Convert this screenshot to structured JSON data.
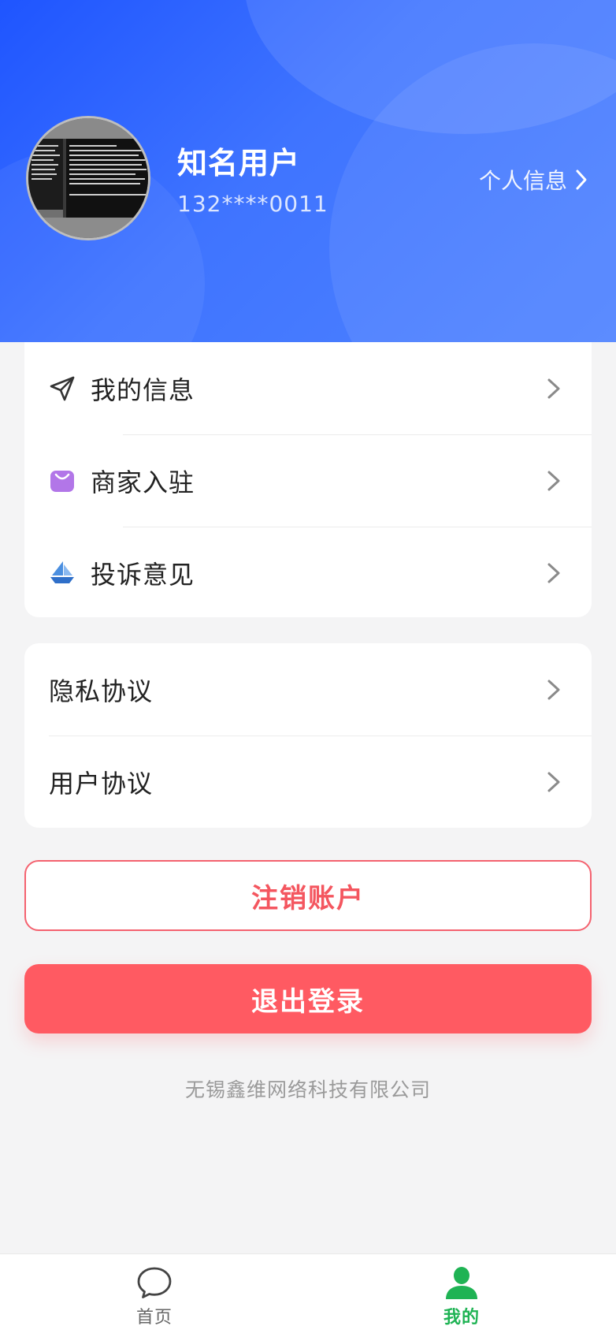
{
  "profile": {
    "name": "知名用户",
    "phone": "132****0011",
    "link_label": "个人信息"
  },
  "menu_group_1": [
    {
      "label": "我的信息",
      "icon": "send-icon"
    },
    {
      "label": "商家入驻",
      "icon": "shopping-bag-icon"
    },
    {
      "label": "投诉意见",
      "icon": "sailboat-icon"
    }
  ],
  "menu_group_2": [
    {
      "label": "隐私协议"
    },
    {
      "label": "用户协议"
    }
  ],
  "buttons": {
    "deregister": "注销账户",
    "logout": "退出登录"
  },
  "footer": {
    "company": "无锡鑫维网络科技有限公司"
  },
  "tabbar": {
    "tabs": [
      {
        "label": "首页",
        "icon": "chat-bubble-icon",
        "active": false
      },
      {
        "label": "我的",
        "icon": "user-icon",
        "active": true
      }
    ]
  },
  "colors": {
    "header_blue": "#3f74ff",
    "danger": "#ff5a62",
    "active_tab": "#1fb354"
  }
}
